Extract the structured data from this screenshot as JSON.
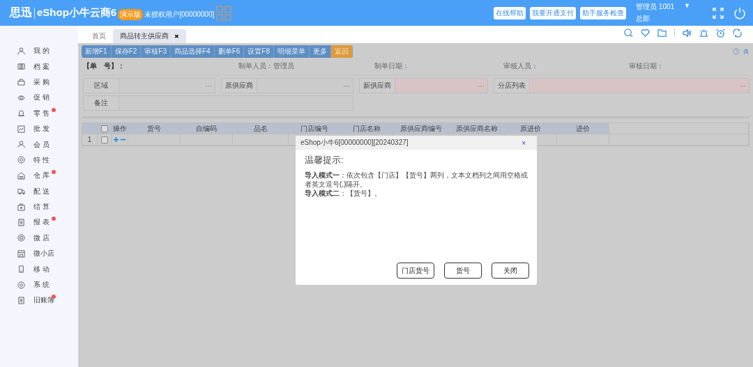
{
  "header": {
    "logo": "思迅",
    "product": "eShop小牛云商6",
    "edition_badge": "演示版",
    "license": "未授权用户[00000000]",
    "links": [
      "在线帮助",
      "我要开通支付",
      "助手服务检查"
    ],
    "user": "管理员 1001",
    "user_caret": "▼",
    "branch": "总部"
  },
  "sidebar": {
    "items": [
      {
        "label": "我 的",
        "badge": false
      },
      {
        "label": "档 案",
        "badge": false
      },
      {
        "label": "采 购",
        "badge": false
      },
      {
        "label": "促 销",
        "badge": false
      },
      {
        "label": "零 售",
        "badge": true
      },
      {
        "label": "批 发",
        "badge": false
      },
      {
        "label": "会 员",
        "badge": false
      },
      {
        "label": "特 性",
        "badge": false
      },
      {
        "label": "仓 库",
        "badge": true
      },
      {
        "label": "配 送",
        "badge": false
      },
      {
        "label": "结 算",
        "badge": false
      },
      {
        "label": "报 表",
        "badge": true
      },
      {
        "label": "微 店",
        "badge": false
      },
      {
        "label": "微小店",
        "badge": false
      },
      {
        "label": "移 动",
        "badge": false
      },
      {
        "label": "系 统",
        "badge": false
      },
      {
        "label": "旧账簿",
        "badge": true
      }
    ]
  },
  "tabs": [
    {
      "label": "首页",
      "selected": false
    },
    {
      "label": "商品转主供应商",
      "selected": true,
      "close": "✖"
    }
  ],
  "toolbar": {
    "buttons": [
      {
        "label": "新增F1",
        "kind": "normal"
      },
      {
        "label": "保存F2",
        "kind": "normal"
      },
      {
        "label": "审核F3",
        "kind": "normal"
      },
      {
        "label": "商品选择F4",
        "kind": "normal"
      },
      {
        "label": "删单F6",
        "kind": "normal"
      },
      {
        "label": "设置F8",
        "kind": "normal"
      },
      {
        "label": "明细菜单",
        "kind": "normal"
      },
      {
        "label": "更多",
        "kind": "normal"
      },
      {
        "label": "返回",
        "kind": "back"
      }
    ]
  },
  "info": [
    "【单　号】：",
    "制单人员：管理员",
    "制单日期：",
    "审核人员：",
    "审核日期："
  ],
  "form": {
    "fields": [
      {
        "label": "区域",
        "picker": "···",
        "required": false
      },
      {
        "label": "原供应商",
        "picker": "···",
        "required": false
      },
      {
        "label": "新供应商",
        "picker": "···",
        "required": true
      },
      {
        "label": "分店列表",
        "picker": "···",
        "required": true
      }
    ],
    "remark": {
      "label": "备注"
    }
  },
  "table": {
    "select_all_checked": false,
    "columns": [
      "操作",
      "货号",
      "自编码",
      "品名",
      "门店编号",
      "门店名称",
      "原供应商编号",
      "原供应商名称",
      "原进价",
      "进价"
    ],
    "rows": [
      {
        "index": "1",
        "checked": false
      }
    ]
  },
  "dialog": {
    "title": "eShop小牛6[00000000][20240327]",
    "close": "×",
    "heading": "温馨提示:",
    "lines": [
      "**导入模式一**：依次包含【门店】【货号】两列，文本文档列之间用空格或者英文逗号(,)隔开。",
      "**导入模式二**：【货号】。"
    ],
    "buttons": [
      "门店货号",
      "货号",
      "关闭"
    ]
  }
}
